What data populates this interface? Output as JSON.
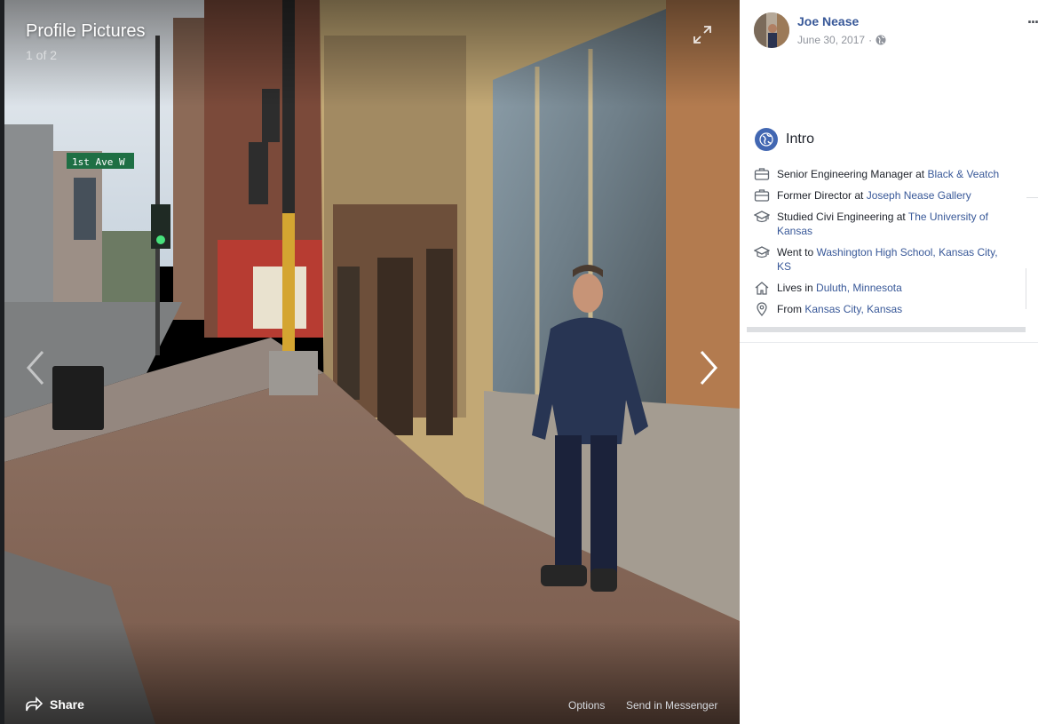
{
  "viewer": {
    "album_title": "Profile Pictures",
    "photo_count": "1 of 2",
    "icons": {
      "expand": "expand-icon",
      "prev": "chevron-left-icon",
      "next": "chevron-right-icon",
      "share": "share-arrow-icon"
    },
    "share_label": "Share",
    "options_label": "Options",
    "messenger_label": "Send in Messenger",
    "street_sign": "1st Ave W"
  },
  "post": {
    "poster_name": "Joe Nease",
    "date": "June 30, 2017",
    "separator": "·",
    "audience_icon": "globe-icon",
    "more_label": "..."
  },
  "intro": {
    "title": "Intro",
    "items": [
      {
        "icon": "briefcase-icon",
        "prefix": "Senior Engineering Manager at ",
        "link": "Black & Veatch"
      },
      {
        "icon": "briefcase-icon",
        "prefix": "Former Director at ",
        "link": "Joseph Nease Gallery"
      },
      {
        "icon": "graduation-cap-icon",
        "prefix": "Studied Civi Engineering at ",
        "link": "The University of Kansas"
      },
      {
        "icon": "graduation-cap-icon",
        "prefix": "Went to ",
        "link": "Washington High School, Kansas City, KS"
      },
      {
        "icon": "house-icon",
        "prefix": "Lives in ",
        "link": "Duluth, Minnesota"
      },
      {
        "icon": "location-pin-icon",
        "prefix": "From ",
        "link": "Kansas City, Kansas"
      }
    ]
  }
}
